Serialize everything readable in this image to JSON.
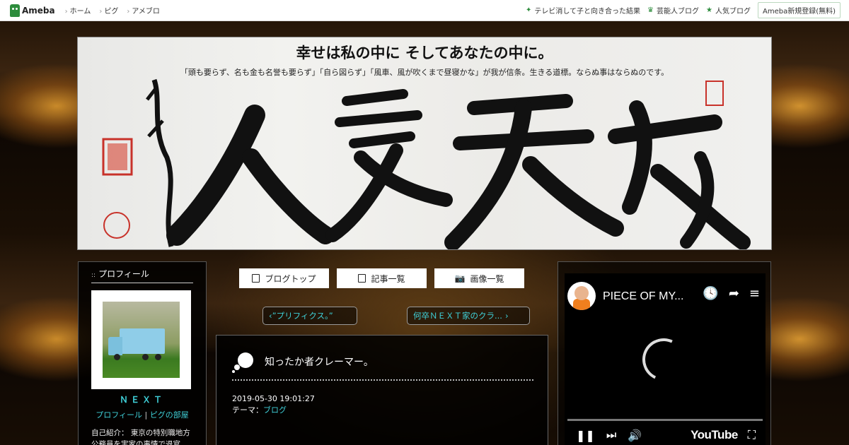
{
  "topbar": {
    "logo": "Ameba",
    "nav": [
      "ホーム",
      "ピグ",
      "アメブロ"
    ],
    "right_links": [
      {
        "icon": "sparkle-icon",
        "label": "テレビ消して子と向き合った結果"
      },
      {
        "icon": "crown-icon",
        "label": "芸能人ブログ"
      },
      {
        "icon": "star-icon",
        "label": "人気ブログ"
      }
    ],
    "register": "Ameba新規登録(無料)"
  },
  "banner": {
    "title": "幸せは私の中に そしてあなたの中に。",
    "subtitle": "「頭も要らず、名も金も名誉も要らず」「自ら図らず」「風車、風が吹くまで昼寝かな」が我が信条。生きる道標。ならぬ事はならぬのです。",
    "calligraphy": "敬天愛人"
  },
  "profile": {
    "heading": "プロフィール",
    "name": "ＮＥＸＴ",
    "link_profile": "プロフィール",
    "separator": "|",
    "link_room": "ピグの部屋",
    "intro": "自己紹介： 東京の特別職地方公務員を実家の事情で退官"
  },
  "buttons": {
    "blog_top": "ブログトップ",
    "articles": "記事一覧",
    "images": "画像一覧"
  },
  "pager": {
    "prev": "”プリフィクス。”",
    "next": "何卒ＮＥＸＴ家のクラ..."
  },
  "entry": {
    "title": "知ったか者クレーマー。",
    "datetime": "2019-05-30 19:01:27",
    "theme_label": "テーマ：",
    "theme": "ブログ"
  },
  "video": {
    "title": "PIECE OF MY...",
    "brand": "YouTube"
  }
}
